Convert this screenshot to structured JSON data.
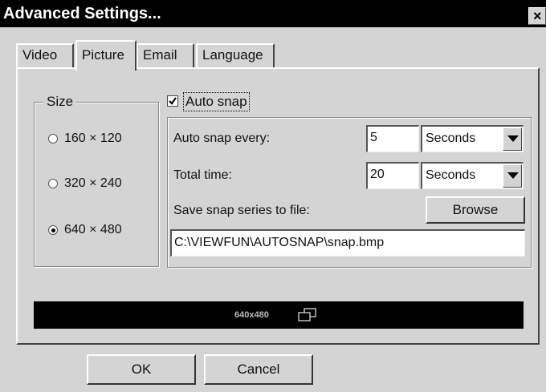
{
  "window": {
    "title": "Advanced Settings...",
    "close_glyph": "×"
  },
  "tabs": [
    {
      "label": "Video",
      "selected": false
    },
    {
      "label": "Picture",
      "selected": true
    },
    {
      "label": "Email",
      "selected": false
    },
    {
      "label": "Language",
      "selected": false
    }
  ],
  "size_group": {
    "legend": "Size",
    "options": [
      {
        "label": "160 × 120",
        "selected": false
      },
      {
        "label": "320 × 240",
        "selected": false
      },
      {
        "label": "640 × 480",
        "selected": true
      }
    ]
  },
  "auto_snap": {
    "checkbox_label": "Auto snap",
    "checked": true,
    "every_label": "Auto snap every:",
    "every_value": "5",
    "every_unit": "Seconds",
    "total_label": "Total time:",
    "total_value": "20",
    "total_unit": "Seconds",
    "save_label": "Save snap series to file:",
    "browse_label": "Browse",
    "file_path": "C:\\VIEWFUN\\AUTOSNAP\\snap.bmp"
  },
  "status": {
    "resolution": "640x480",
    "icon": "windows-icon"
  },
  "buttons": {
    "ok": "OK",
    "cancel": "Cancel"
  }
}
